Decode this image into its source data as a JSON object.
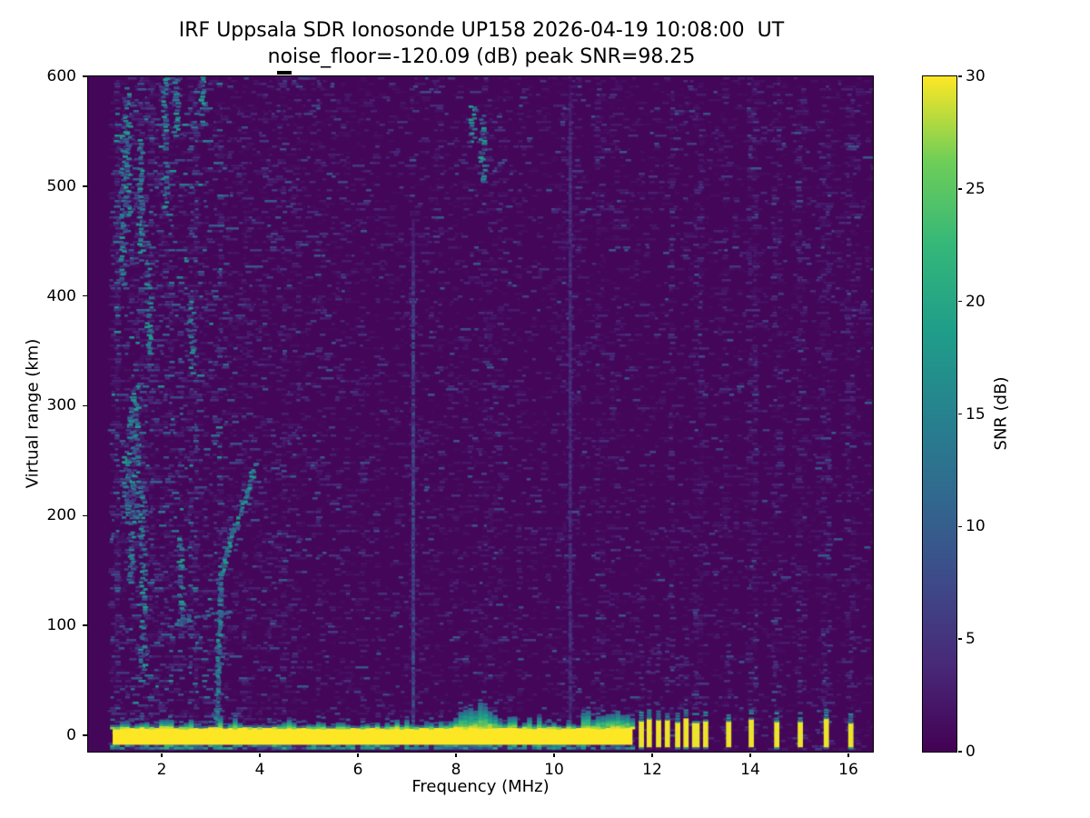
{
  "figure": {
    "kind": "ionogram heatmap screenshot",
    "background": "#ffffff"
  },
  "chart_data": {
    "type": "heatmap",
    "title": "IRF Uppsala SDR Ionosonde UP158 2026-04-19 10:08:00  UT",
    "subtitle": "noise_floor=-120.09 (dB) peak SNR=98.25",
    "xlabel": "Frequency (MHz)",
    "ylabel": "Virtual range (km)",
    "xlim": [
      0.5,
      16.5
    ],
    "ylim": [
      -15,
      600
    ],
    "xticks": [
      2,
      4,
      6,
      8,
      10,
      12,
      14,
      16
    ],
    "yticks": [
      0,
      100,
      200,
      300,
      400,
      500,
      600
    ],
    "grid": false,
    "noise_floor_db": -120.09,
    "peak_snr_db": 98.25,
    "data_min_freq_mhz": 1.0,
    "colorbar": {
      "label": "SNR (dB)",
      "ticks": [
        0,
        5,
        10,
        15,
        20,
        25,
        30
      ],
      "clim": [
        0,
        30
      ],
      "cmap": "viridis",
      "position": "right"
    },
    "features": {
      "noise_speckle": {
        "seed": 1337,
        "base_density": 0.5,
        "left_region_max_mhz": 3.4,
        "left_boost": 1.8
      },
      "ground_band": {
        "f0": 1.0,
        "f1": 11.6,
        "alt0": -9,
        "alt1": 9,
        "snr": 30,
        "bump": {
          "f0": 8.0,
          "f1": 8.9,
          "top_km": 26
        }
      },
      "transmit_pulses_mhz": [
        11.78,
        11.94,
        12.13,
        12.31,
        12.52,
        12.69,
        12.89,
        13.09,
        13.56,
        14.02,
        14.54,
        15.02,
        15.55,
        16.05
      ],
      "pulse_alt_range_km": [
        -12,
        14
      ],
      "interference_lines": [
        {
          "f": 7.13,
          "alt0": -5,
          "alt1": 470,
          "snr": 8.5
        },
        {
          "f": 10.33,
          "alt0": 0,
          "alt1": 600,
          "snr": 5
        }
      ],
      "echo_trace": {
        "segments": [
          {
            "points": [
              [
                3.12,
                5
              ],
              [
                3.17,
                80
              ],
              [
                3.22,
                145
              ]
            ],
            "snr": 14
          },
          {
            "points": [
              [
                3.22,
                145
              ],
              [
                3.45,
                185
              ],
              [
                3.68,
                210
              ],
              [
                3.93,
                248
              ]
            ],
            "snr": 15
          },
          {
            "points": [
              [
                2.3,
                102
              ],
              [
                3.4,
                113
              ]
            ],
            "snr": 11
          }
        ]
      },
      "left_streaks": [
        {
          "f": 1.22,
          "alt0": 410,
          "alt1": 565
        },
        {
          "f": 1.32,
          "alt0": 470,
          "alt1": 590
        },
        {
          "f": 1.58,
          "alt0": 430,
          "alt1": 545
        },
        {
          "f": 1.75,
          "alt0": 345,
          "alt1": 430
        },
        {
          "f": 2.08,
          "alt0": 480,
          "alt1": 600
        },
        {
          "f": 2.3,
          "alt0": 545,
          "alt1": 600
        },
        {
          "f": 1.38,
          "alt0": 140,
          "alt1": 300
        },
        {
          "f": 1.62,
          "alt0": 60,
          "alt1": 230
        },
        {
          "f": 2.62,
          "alt0": 330,
          "alt1": 395
        },
        {
          "f": 1.48,
          "alt0": 195,
          "alt1": 320
        },
        {
          "f": 2.85,
          "alt0": 555,
          "alt1": 600
        },
        {
          "f": 2.4,
          "alt0": 100,
          "alt1": 180
        },
        {
          "f": 1.28,
          "alt0": 190,
          "alt1": 255
        }
      ],
      "high_streaks": [
        {
          "f": 8.55,
          "alt0": 505,
          "alt1": 565
        },
        {
          "f": 8.35,
          "alt0": 540,
          "alt1": 575
        }
      ],
      "faint_right_columns_mhz": [
        12.4,
        12.95,
        13.5,
        14.05,
        14.55,
        15.05,
        15.55,
        16.05
      ],
      "top_marker": {
        "f0": 4.35,
        "f1": 4.65,
        "note": "black dash above top axis"
      }
    }
  }
}
